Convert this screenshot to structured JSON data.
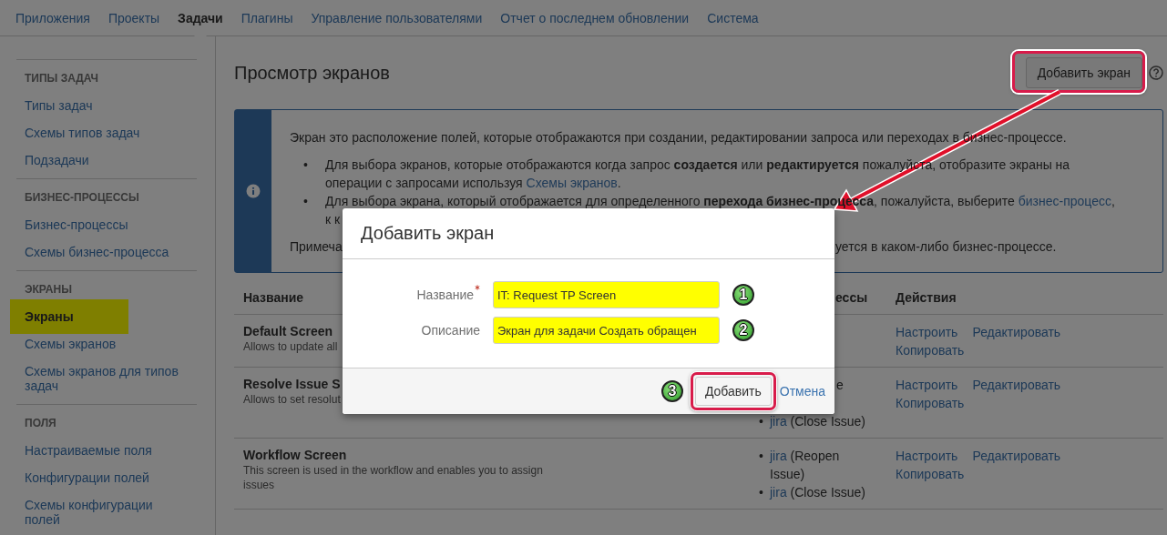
{
  "nav": {
    "items": [
      {
        "label": "Приложения",
        "selected": false
      },
      {
        "label": "Проекты",
        "selected": false
      },
      {
        "label": "Задачи",
        "selected": true
      },
      {
        "label": "Плагины",
        "selected": false
      },
      {
        "label": "Управление пользователями",
        "selected": false
      },
      {
        "label": "Отчет о последнем обновлении",
        "selected": false
      },
      {
        "label": "Система",
        "selected": false
      }
    ]
  },
  "sidebar": {
    "groups": [
      {
        "heading": "ТИПЫ ЗАДАЧ",
        "items": [
          {
            "label": "Типы задач",
            "selected": false,
            "highlighted": false
          },
          {
            "label": "Схемы типов задач",
            "selected": false,
            "highlighted": false
          },
          {
            "label": "Подзадачи",
            "selected": false,
            "highlighted": false
          }
        ]
      },
      {
        "heading": "БИЗНЕС-ПРОЦЕССЫ",
        "items": [
          {
            "label": "Бизнес-процессы",
            "selected": false,
            "highlighted": false
          },
          {
            "label": "Схемы бизнес-процесса",
            "selected": false,
            "highlighted": false
          }
        ]
      },
      {
        "heading": "ЭКРАНЫ",
        "items": [
          {
            "label": "Экраны",
            "selected": true,
            "highlighted": true
          },
          {
            "label": "Схемы экранов",
            "selected": false,
            "highlighted": false
          },
          {
            "label": "Схемы экранов для типов задач",
            "selected": false,
            "highlighted": false
          }
        ]
      },
      {
        "heading": "ПОЛЯ",
        "items": [
          {
            "label": "Настраиваемые поля",
            "selected": false,
            "highlighted": false
          },
          {
            "label": "Конфигурации полей",
            "selected": false,
            "highlighted": false
          },
          {
            "label": "Схемы конфигурации полей",
            "selected": false,
            "highlighted": false
          }
        ]
      }
    ]
  },
  "page": {
    "title": "Просмотр экранов",
    "add_button": {
      "label": "Добавить экран",
      "callout": true
    }
  },
  "info": {
    "intro": [
      {
        "kind": "text",
        "text": "Экран это расположение полей, которые отображаются при создании, редактировании запроса или переходах в бизнес-процессе."
      }
    ],
    "bullets": [
      {
        "marker": "•",
        "lines": [
          [
            {
              "kind": "text",
              "text": "Для выбора экранов, которые отображаются когда запрос **создается** или **редактируется** пожалуйста, отобразите экраны на"
            }
          ],
          [
            {
              "kind": "text",
              "text": "операции с запросами используя "
            },
            {
              "kind": "link",
              "text": "Схемы экранов"
            },
            {
              "kind": "text",
              "text": "."
            }
          ]
        ]
      },
      {
        "marker": "•",
        "lines": [
          [
            {
              "kind": "text",
              "text": "Для выбора экрана, который отображается для определенного **перехода бизнес-процесса**, пожалуйста, выберите "
            },
            {
              "kind": "link",
              "text": "бизнес-процесс"
            },
            {
              "kind": "text",
              "text": ","
            }
          ],
          [
            {
              "kind": "text",
              "text": "к к"
            }
          ]
        ]
      }
    ],
    "note": [
      "Примеча",
      "уется в каком-либо бизнес-процессе."
    ]
  },
  "table": {
    "columns": [
      "Название",
      "ессы",
      "Действия"
    ],
    "rows": [
      {
        "name": "Default Screen",
        "description": "Allows to update all",
        "workflow_fragment": "",
        "workflows": [],
        "actions": [
          "Настроить",
          "Редактировать",
          "Копировать"
        ]
      },
      {
        "name": "Resolve Issue S",
        "description": "Allows to set resolut",
        "workflow_fragment": "e",
        "workflows": [
          {
            "marker": "•",
            "link": "jira",
            "text": "(Close Issue)"
          }
        ],
        "actions": [
          "Настроить",
          "Редактировать",
          "Копировать"
        ]
      },
      {
        "name": "Workflow Screen",
        "description": "This screen is used in the workflow and enables you to assign issues",
        "workflow_fragment": "",
        "workflows": [
          {
            "marker": "•",
            "link": "jira",
            "text": "(Reopen Issue)"
          },
          {
            "marker": "•",
            "link": "jira",
            "text": "(Close Issue)"
          }
        ],
        "actions": [
          "Настроить",
          "Редактировать",
          "Копировать"
        ]
      }
    ]
  },
  "dialog": {
    "title": "Добавить экран",
    "fields": [
      {
        "label": "Название",
        "required": true,
        "value": "IT: Request TP Screen",
        "step": "1"
      },
      {
        "label": "Описание",
        "required": false,
        "value": "Экран для задачи Создать обращен",
        "step": "2"
      }
    ],
    "submit": {
      "label": "Добавить",
      "callout": true,
      "step": "3"
    },
    "cancel": "Отмена"
  }
}
